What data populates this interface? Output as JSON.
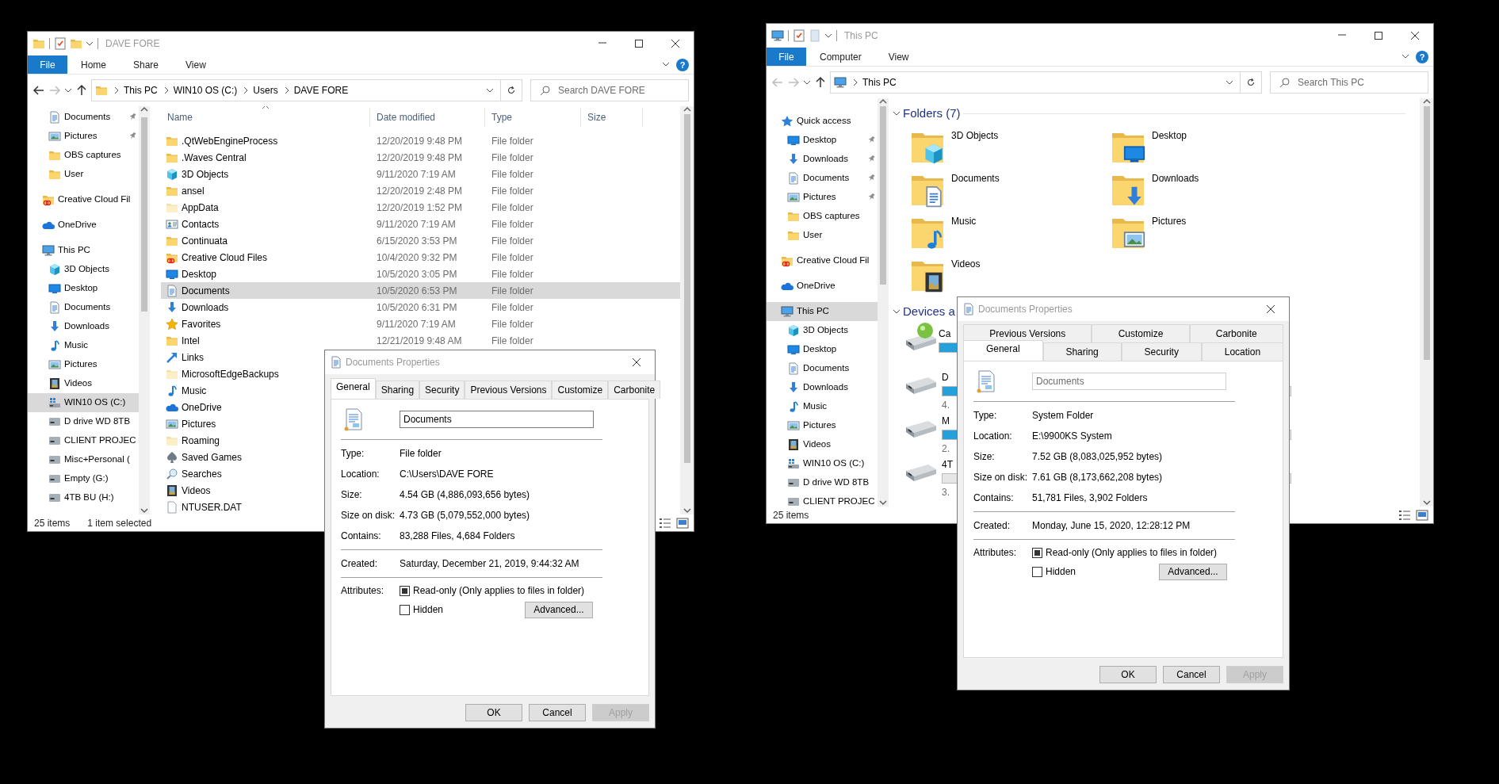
{
  "windows": [
    {
      "kind": "details",
      "title": "DAVE FORE",
      "toolbar_icons": [
        {
          "kind": "folder"
        },
        {
          "kind": "properties"
        },
        {
          "kind": "folder"
        }
      ],
      "ribbon_tabs": [
        {
          "label": "File",
          "kind": "file"
        },
        {
          "label": "Home",
          "kind": "tab"
        },
        {
          "label": "Share",
          "kind": "tab"
        },
        {
          "label": "View",
          "kind": "tab"
        }
      ],
      "help": "?",
      "back_disabled": false,
      "forward_disabled": true,
      "address": {
        "kind": "folder",
        "crumbs": [
          "This PC",
          "WIN10 OS (C:)",
          "Users",
          "DAVE FORE"
        ]
      },
      "search": {
        "placeholder": "Search DAVE FORE"
      },
      "nav": [
        {
          "children": [
            {
              "label": "Documents",
              "kind": "documents",
              "pinned": true,
              "selected": false
            },
            {
              "label": "Pictures",
              "kind": "pictures",
              "pinned": true,
              "selected": false
            },
            {
              "label": "OBS captures",
              "kind": "folder",
              "pinned": false,
              "selected": false
            },
            {
              "label": "User",
              "kind": "folder",
              "pinned": false,
              "selected": false
            }
          ]
        },
        {
          "label": "Creative Cloud Fil",
          "kind": "creative",
          "pinned": false,
          "selected": false
        },
        {
          "label": "OneDrive",
          "kind": "onedrive",
          "pinned": false,
          "selected": false
        },
        {
          "label": "This PC",
          "kind": "pc",
          "pinned": false,
          "selected": false,
          "children": [
            {
              "label": "3D Objects",
              "kind": "objects3d",
              "pinned": false,
              "selected": false
            },
            {
              "label": "Desktop",
              "kind": "desktop",
              "pinned": false,
              "selected": false
            },
            {
              "label": "Documents",
              "kind": "documents",
              "pinned": false,
              "selected": false
            },
            {
              "label": "Downloads",
              "kind": "downloads",
              "pinned": false,
              "selected": false
            },
            {
              "label": "Music",
              "kind": "music",
              "pinned": false,
              "selected": false
            },
            {
              "label": "Pictures",
              "kind": "pictures",
              "pinned": false,
              "selected": false
            },
            {
              "label": "Videos",
              "kind": "videos",
              "pinned": false,
              "selected": false
            },
            {
              "label": "WIN10 OS (C:)",
              "kind": "winos",
              "pinned": false,
              "selected": true
            },
            {
              "label": "D drive WD 8TB",
              "kind": "drive",
              "pinned": false,
              "selected": false
            },
            {
              "label": "CLIENT PROJEC",
              "kind": "drive",
              "pinned": false,
              "selected": false
            },
            {
              "label": "Misc+Personal (",
              "kind": "drive",
              "pinned": false,
              "selected": false
            },
            {
              "label": "Empty (G:)",
              "kind": "drive",
              "pinned": false,
              "selected": false
            },
            {
              "label": "4TB BU (H:)",
              "kind": "drive",
              "pinned": false,
              "selected": false
            }
          ]
        }
      ],
      "columns": [
        {
          "label": "Name",
          "sorted": true
        },
        {
          "label": "Date modified",
          "sorted": false
        },
        {
          "label": "Type",
          "sorted": false
        },
        {
          "label": "Size",
          "sorted": false
        }
      ],
      "rows": [
        {
          "name": ".QtWebEngineProcess",
          "date": "12/20/2019 9:48 PM",
          "type": "File folder",
          "kind": "folder",
          "selected": false
        },
        {
          "name": ".Waves Central",
          "date": "12/20/2019 9:48 PM",
          "type": "File folder",
          "kind": "folder",
          "selected": false
        },
        {
          "name": "3D Objects",
          "date": "9/11/2020 7:19 AM",
          "type": "File folder",
          "kind": "objects3d",
          "selected": false
        },
        {
          "name": "ansel",
          "date": "12/20/2019 2:48 PM",
          "type": "File folder",
          "kind": "folder",
          "selected": false
        },
        {
          "name": "AppData",
          "date": "12/20/2019 1:52 PM",
          "type": "File folder",
          "kind": "folder_hidden",
          "selected": false
        },
        {
          "name": "Contacts",
          "date": "9/11/2020 7:19 AM",
          "type": "File folder",
          "kind": "contacts",
          "selected": false
        },
        {
          "name": "Continuata",
          "date": "6/15/2020 3:53 PM",
          "type": "File folder",
          "kind": "folder",
          "selected": false
        },
        {
          "name": "Creative Cloud Files",
          "date": "10/4/2020 9:32 PM",
          "type": "File folder",
          "kind": "creative",
          "selected": false
        },
        {
          "name": "Desktop",
          "date": "10/5/2020 3:05 PM",
          "type": "File folder",
          "kind": "desktop",
          "selected": false
        },
        {
          "name": "Documents",
          "date": "10/5/2020 6:53 PM",
          "type": "File folder",
          "kind": "documents",
          "selected": true
        },
        {
          "name": "Downloads",
          "date": "10/5/2020 6:31 PM",
          "type": "File folder",
          "kind": "downloads",
          "selected": false
        },
        {
          "name": "Favorites",
          "date": "9/11/2020 7:19 AM",
          "type": "File folder",
          "kind": "favorites",
          "selected": false
        },
        {
          "name": "Intel",
          "date": "12/21/2019 9:48 AM",
          "type": "File folder",
          "kind": "folder",
          "selected": false
        },
        {
          "name": "Links",
          "kind": "links",
          "selected": false
        },
        {
          "name": "MicrosoftEdgeBackups",
          "kind": "folder_hidden",
          "selected": false
        },
        {
          "name": "Music",
          "kind": "music",
          "selected": false
        },
        {
          "name": "OneDrive",
          "kind": "onedrive",
          "selected": false
        },
        {
          "name": "Pictures",
          "kind": "pictures",
          "selected": false
        },
        {
          "name": "Roaming",
          "kind": "folder_hidden",
          "selected": false
        },
        {
          "name": "Saved Games",
          "kind": "games",
          "selected": false
        },
        {
          "name": "Searches",
          "kind": "searches",
          "selected": false
        },
        {
          "name": "Videos",
          "kind": "videos",
          "selected": false
        },
        {
          "name": "NTUSER.DAT",
          "kind": "file",
          "selected": false
        }
      ],
      "status": [
        "25 items",
        "1 item selected"
      ]
    },
    {
      "kind": "tiles",
      "title": "This PC",
      "toolbar_icons": [
        {
          "kind": "pc"
        },
        {
          "kind": "properties"
        },
        {
          "kind": "page"
        }
      ],
      "ribbon_tabs": [
        {
          "label": "File",
          "kind": "file"
        },
        {
          "label": "Computer",
          "kind": "tab"
        },
        {
          "label": "View",
          "kind": "tab"
        }
      ],
      "help": "?",
      "back_disabled": true,
      "forward_disabled": true,
      "address": {
        "kind": "pc",
        "crumbs": [
          "This PC"
        ]
      },
      "search": {
        "placeholder": "Search This PC"
      },
      "nav": [
        {
          "label": "Quick access",
          "kind": "quick",
          "pinned": false,
          "selected": false,
          "children": [
            {
              "label": "Desktop",
              "kind": "desktop",
              "pinned": true,
              "selected": false
            },
            {
              "label": "Downloads",
              "kind": "downloads",
              "pinned": true,
              "selected": false
            },
            {
              "label": "Documents",
              "kind": "documents",
              "pinned": true,
              "selected": false
            },
            {
              "label": "Pictures",
              "kind": "pictures",
              "pinned": true,
              "selected": false
            },
            {
              "label": "OBS captures",
              "kind": "folder",
              "pinned": false,
              "selected": false
            },
            {
              "label": "User",
              "kind": "folder",
              "pinned": false,
              "selected": false
            }
          ]
        },
        {
          "label": "Creative Cloud Fil",
          "kind": "creative",
          "pinned": false,
          "selected": false
        },
        {
          "label": "OneDrive",
          "kind": "onedrive",
          "pinned": false,
          "selected": false
        },
        {
          "label": "This PC",
          "kind": "pc",
          "pinned": false,
          "selected": true,
          "children": [
            {
              "label": "3D Objects",
              "kind": "objects3d",
              "pinned": false,
              "selected": false
            },
            {
              "label": "Desktop",
              "kind": "desktop",
              "pinned": false,
              "selected": false
            },
            {
              "label": "Documents",
              "kind": "documents",
              "pinned": false,
              "selected": false
            },
            {
              "label": "Downloads",
              "kind": "downloads",
              "pinned": false,
              "selected": false
            },
            {
              "label": "Music",
              "kind": "music",
              "pinned": false,
              "selected": false
            },
            {
              "label": "Pictures",
              "kind": "pictures",
              "pinned": false,
              "selected": false
            },
            {
              "label": "Videos",
              "kind": "videos",
              "pinned": false,
              "selected": false
            },
            {
              "label": "WIN10 OS (C:)",
              "kind": "winos",
              "pinned": false,
              "selected": false
            },
            {
              "label": "D drive WD 8TB",
              "kind": "drive",
              "pinned": false,
              "selected": false
            },
            {
              "label": "CLIENT PROJEC",
              "kind": "drive",
              "pinned": false,
              "selected": false
            }
          ]
        }
      ],
      "groups": [
        {
          "title": "Folders (7)",
          "kind": "folders",
          "expanded": true,
          "items": [
            {
              "label": "3D Objects",
              "kind": "objects3d"
            },
            {
              "label": "Desktop",
              "kind": "desktop"
            },
            {
              "label": "Documents",
              "kind": "documents"
            },
            {
              "label": "Downloads",
              "kind": "downloads"
            },
            {
              "label": "Music",
              "kind": "music"
            },
            {
              "label": "Pictures",
              "kind": "pictures"
            },
            {
              "label": "Videos",
              "kind": "videos"
            }
          ]
        },
        {
          "title": "Devices a",
          "kind": "drives",
          "expanded": true,
          "items": [
            {
              "label": "Ca",
              "kind": "disc",
              "level": 0.5
            },
            {
              "label": "D",
              "kind": "drive",
              "level": 0.5,
              "detail": "4."
            },
            {
              "label": "M",
              "kind": "drive",
              "level": 0.5,
              "detail": "2."
            },
            {
              "label": "4T",
              "kind": "drive",
              "level": 0,
              "detail": "3."
            }
          ]
        }
      ],
      "status": [
        "25 items"
      ]
    }
  ],
  "dialogs": [
    {
      "title": "Documents Properties",
      "tab_rows": [
        [
          {
            "label": "General",
            "selected": true
          },
          {
            "label": "Sharing",
            "selected": false
          },
          {
            "label": "Security",
            "selected": false
          },
          {
            "label": "Previous Versions",
            "selected": false
          },
          {
            "label": "Customize",
            "selected": false
          },
          {
            "label": "Carbonite",
            "selected": false
          }
        ]
      ],
      "name": {
        "value": "Documents",
        "disabled": false
      },
      "groups": [
        [
          {
            "label": "Type:",
            "value": "File folder"
          },
          {
            "label": "Location:",
            "value": "C:\\Users\\DAVE FORE"
          },
          {
            "label": "Size:",
            "value": "4.54 GB (4,886,093,656 bytes)"
          },
          {
            "label": "Size on disk:",
            "value": "4.73 GB (5,079,552,000 bytes)"
          },
          {
            "label": "Contains:",
            "value": "83,288 Files, 4,684 Folders"
          }
        ],
        [
          {
            "label": "Created:",
            "value": "Saturday, December 21, 2019, 9:44:32 AM"
          }
        ]
      ],
      "attributes": {
        "label": "Attributes:",
        "options": [
          {
            "label": "Read-only (Only applies to files in folder)",
            "checked": false,
            "indeterminate": true
          },
          {
            "label": "Hidden",
            "checked": false,
            "indeterminate": false
          }
        ],
        "advanced": "Advanced..."
      },
      "buttons": [
        {
          "label": "OK",
          "disabled": false
        },
        {
          "label": "Cancel",
          "disabled": false
        },
        {
          "label": "Apply",
          "disabled": true
        }
      ]
    },
    {
      "title": "Documents Properties",
      "tab_rows": [
        [
          {
            "label": "Previous Versions",
            "selected": false
          },
          {
            "label": "Customize",
            "selected": false
          },
          {
            "label": "Carbonite",
            "selected": false
          }
        ],
        [
          {
            "label": "General",
            "selected": true
          },
          {
            "label": "Sharing",
            "selected": false
          },
          {
            "label": "Security",
            "selected": false
          },
          {
            "label": "Location",
            "selected": false
          }
        ]
      ],
      "name": {
        "value": "Documents",
        "disabled": true
      },
      "groups": [
        [
          {
            "label": "Type:",
            "value": "System Folder"
          },
          {
            "label": "Location:",
            "value": "E:\\9900KS System"
          },
          {
            "label": "Size:",
            "value": "7.52 GB (8,083,025,952 bytes)"
          },
          {
            "label": "Size on disk:",
            "value": "7.61 GB (8,173,662,208 bytes)"
          },
          {
            "label": "Contains:",
            "value": "51,781 Files, 3,902 Folders"
          }
        ],
        [
          {
            "label": "Created:",
            "value": "Monday, June 15, 2020, 12:28:12 PM"
          }
        ]
      ],
      "attributes": {
        "label": "Attributes:",
        "options": [
          {
            "label": "Read-only (Only applies to files in folder)",
            "checked": false,
            "indeterminate": true
          },
          {
            "label": "Hidden",
            "checked": false,
            "indeterminate": false
          }
        ],
        "advanced": "Advanced..."
      },
      "buttons": [
        {
          "label": "OK",
          "disabled": false
        },
        {
          "label": "Cancel",
          "disabled": false
        },
        {
          "label": "Apply",
          "disabled": true
        }
      ]
    }
  ]
}
